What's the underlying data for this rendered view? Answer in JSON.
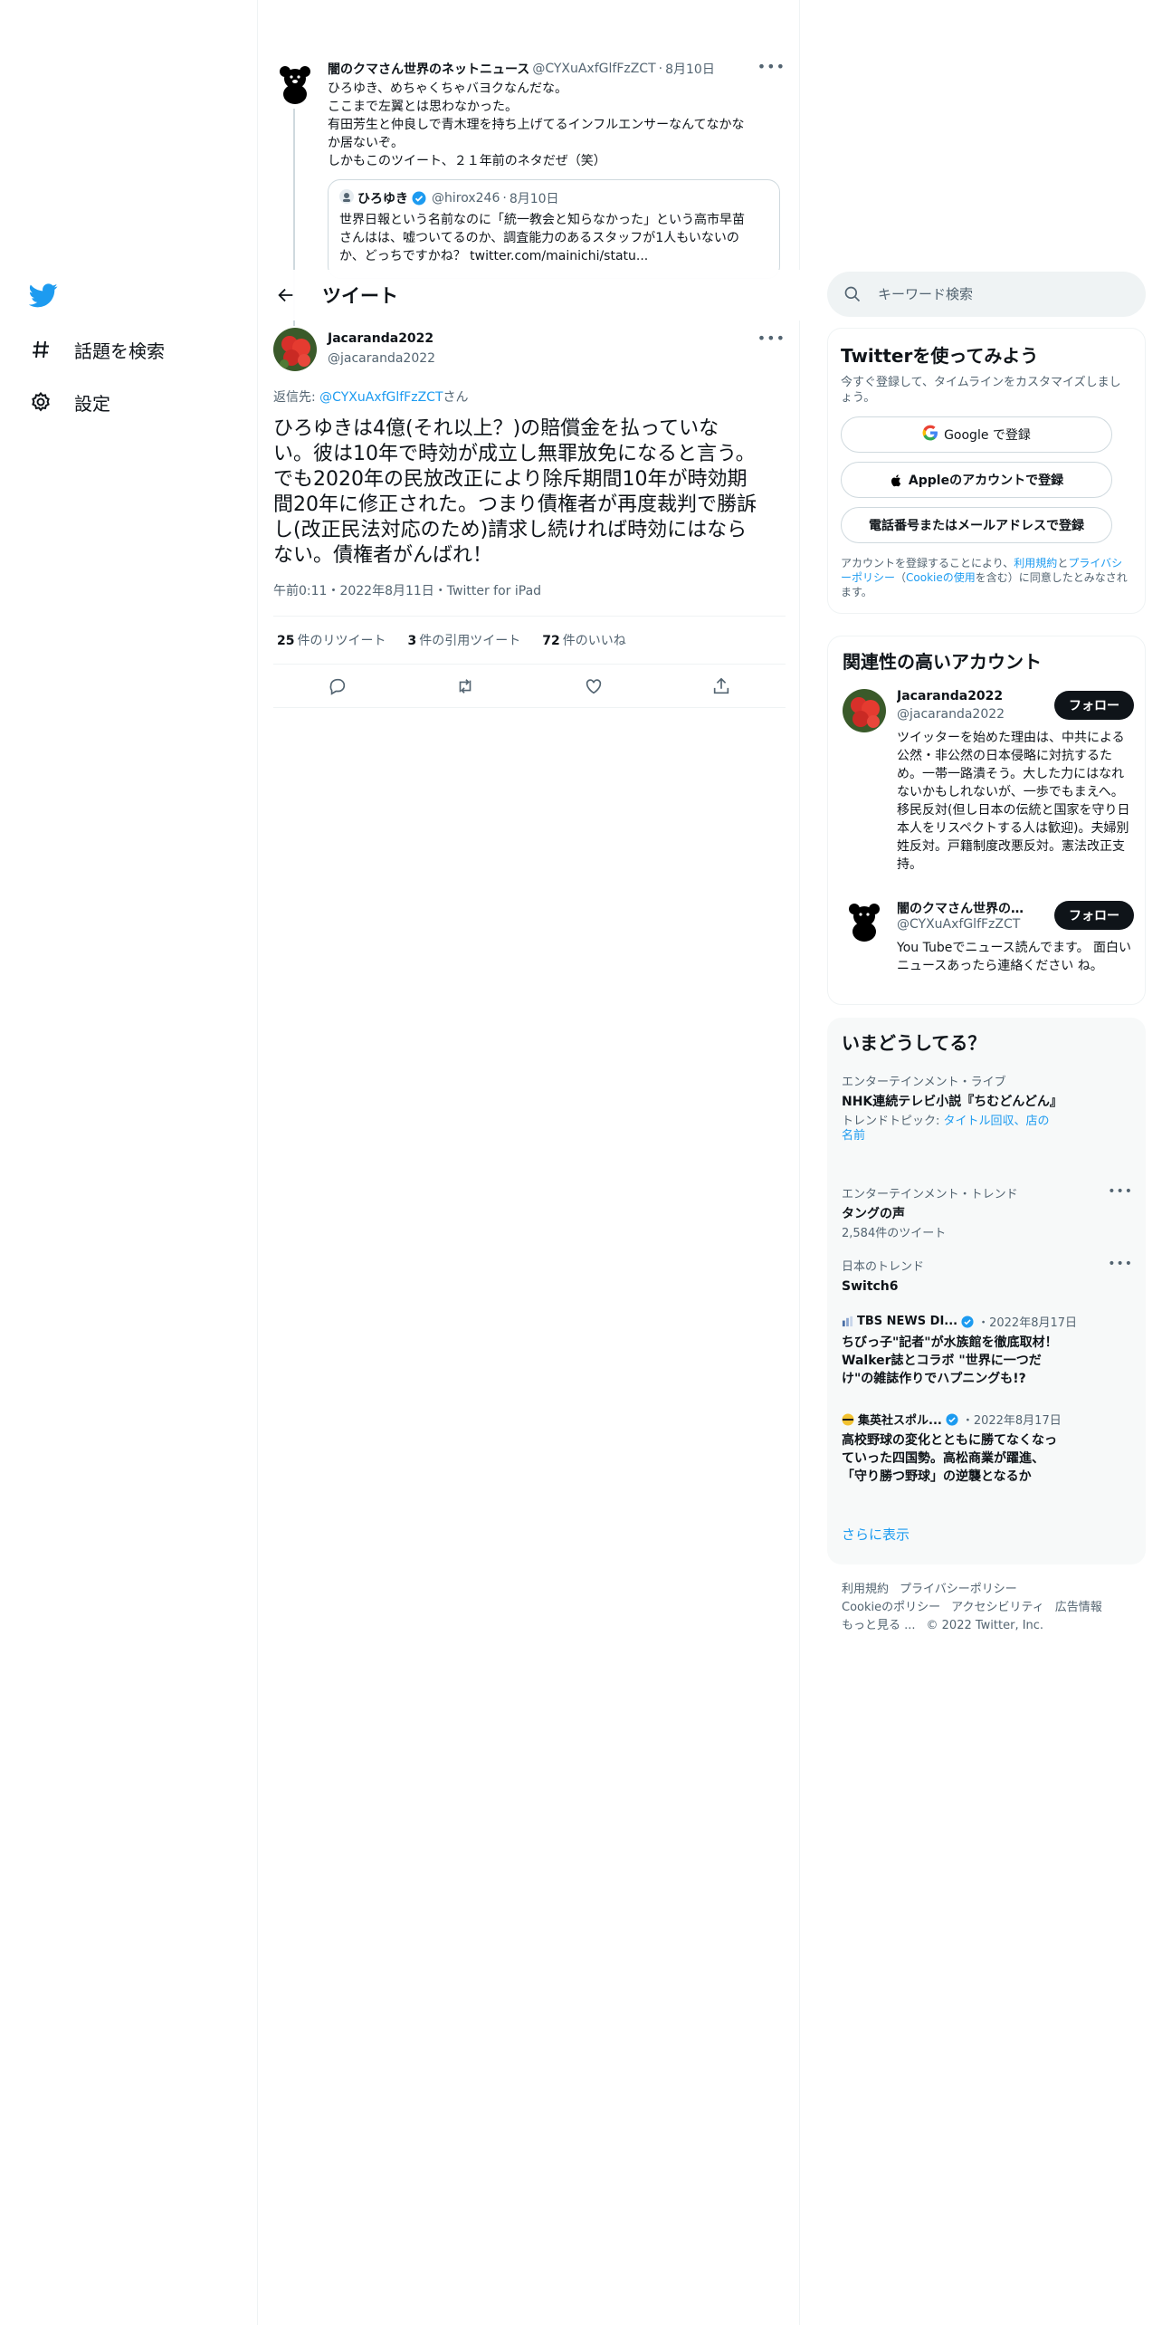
{
  "nav": {
    "explore": "話題を検索",
    "settings": "設定"
  },
  "context_tweet": {
    "name": "闇のクマさん世界のネットニュース",
    "handle": "@CYXuAxfGlfFzZCT",
    "date": "8月10日",
    "lines": [
      "ひろゆき、めちゃくちゃバヨクなんだな。",
      "ここまで左翼とは思わなかった。",
      "有田芳生と仲良しで青木理を持ち上げてるインフルエンサーなんてなかな",
      "か居ないぞ。",
      "しかもこのツイート、２１年前のネタだぜ（笑）"
    ],
    "quote": {
      "name": "ひろゆき",
      "handle": "@hirox246",
      "date": "8月10日",
      "lines": [
        "世界日報という名前なのに「統一教会と知らなかった」という高市早苗",
        "さんはは、嘘ついてるのか、調査能力のあるスタッフが1人もいないの",
        "か、どっちですかね？ twitter.com/mainichi/statu..."
      ]
    }
  },
  "topbar": {
    "title": "ツイート"
  },
  "tweet": {
    "name": "Jacaranda2022",
    "handle": "@jacaranda2022",
    "reply_prefix": "返信先: ",
    "reply_handle": "@CYXuAxfGlfFzZCT",
    "reply_suffix": "さん",
    "lines": [
      "ひろゆきは4億(それ以上？)の賠償金を払っていな",
      "い。彼は10年で時効が成立し無罪放免になると言う。",
      "でも2020年の民放改正により除斥期間10年が時効期",
      "間20年に修正された。つまり債権者が再度裁判で勝訴",
      "し(改正民法対応のため)請求し続ければ時効にはなら",
      "ない。債権者がんばれ！"
    ],
    "meta": "午前0:11・2022年8月11日・Twitter for iPad",
    "retweets": "25",
    "retweets_label": "件のリツイート",
    "quotes": "3",
    "quotes_label": "件の引用ツイート",
    "likes": "72",
    "likes_label": "件のいいね"
  },
  "search": {
    "placeholder": "キーワード検索"
  },
  "signup": {
    "title": "Twitterを使ってみよう",
    "sub": "今すぐ登録して、タイムラインをカスタマイズしましょう。",
    "google": "Google で登録",
    "apple": "Appleのアカウントで登録",
    "phone": "電話番号またはメールアドレスで登録",
    "legal_a": "アカウントを登録することにより、",
    "legal_terms": "利用規約",
    "legal_b": "と",
    "legal_privacy": "プライバシーポリシー",
    "legal_c": "（",
    "legal_cookie": "Cookieの使用",
    "legal_d": "を含む）に同意したとみなされます。"
  },
  "related": {
    "title": "関連性の高いアカウント",
    "follow_label": "フォロー",
    "accounts": [
      {
        "name": "Jacaranda2022",
        "handle": "@jacaranda2022",
        "bio": "ツイッターを始めた理由は、中共による公然・非公然の日本侵略に対抗するため。一帯一路潰そう。大した力にはなれないかもしれないが、一歩でもまえへ。移民反対(但し日本の伝統と国家を守り日本人をリスペクトする人は歓迎)。夫婦別姓反対。戸籍制度改悪反対。憲法改正支持。"
      },
      {
        "name": "闇のクマさん世界のネットニュース",
        "handle": "@CYXuAxfGlfFzZCT",
        "bio": "You Tubeでニュース読んでます。 面白いニュースあったら連絡ください ね。"
      }
    ]
  },
  "trends": {
    "title": "いまどうしてる？",
    "items": [
      {
        "category": "エンターテインメント・ライブ",
        "title": "NHK連続テレビ小説『ちむどんどん』",
        "topic_prefix": "トレンドトピック: ",
        "topic_links": "タイトル回収、店の名前"
      },
      {
        "category": "エンターテインメント・トレンド",
        "title": "タングの声",
        "count": "2,584件のツイート"
      },
      {
        "category": "日本のトレンド",
        "title": "Switch6"
      }
    ],
    "news": [
      {
        "source": "TBS NEWS DI...",
        "date": "・2022年8月17日",
        "title": "ちびっ子\"記者\"が水族館を徹底取材！Walker誌とコラボ \"世界に一つだけ\"の雑誌作りでハプニングも!?"
      },
      {
        "source": "集英社スポル...",
        "date": "・2022年8月17日",
        "title": "高校野球の変化とともに勝てなくなっていった四国勢。高松商業が躍進、「守り勝つ野球」の逆襲となるか"
      }
    ],
    "show_more": "さらに表示"
  },
  "footer": {
    "terms": "利用規約",
    "privacy": "プライバシーポリシー",
    "cookie": "Cookieのポリシー",
    "accessibility": "アクセシビリティ",
    "ads": "広告情報",
    "more": "もっと見る ...",
    "copyright": "© 2022 Twitter, Inc."
  },
  "colors": {
    "accent": "#1d9bf0",
    "text": "#0f1419",
    "muted": "#536471"
  }
}
